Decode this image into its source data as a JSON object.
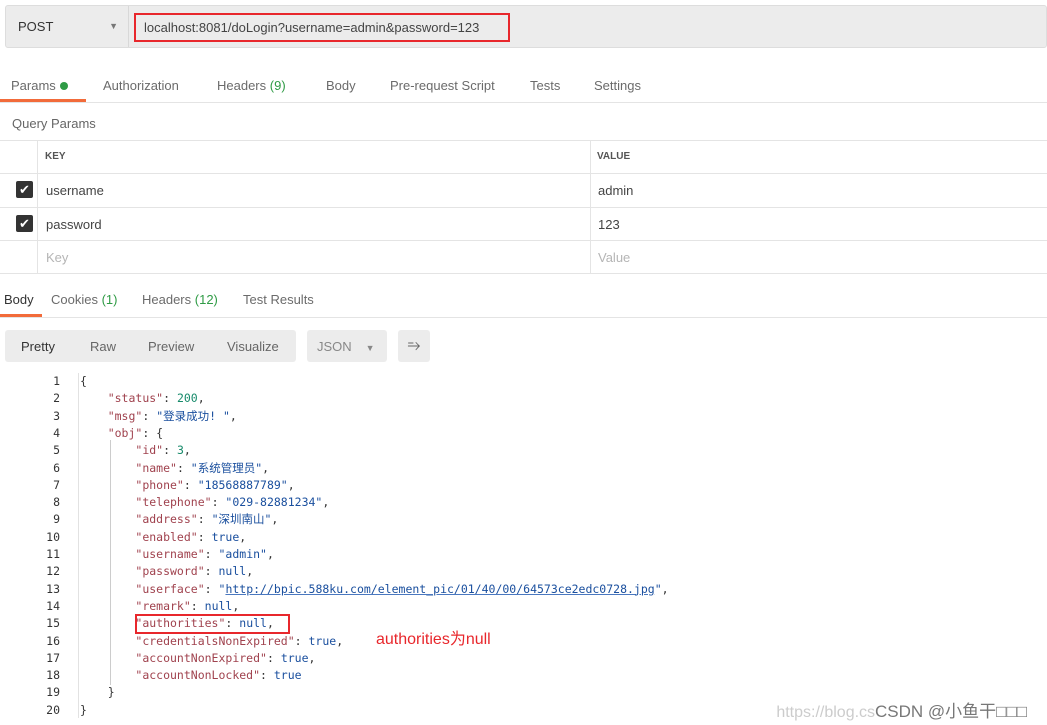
{
  "request": {
    "method": "POST",
    "url": "localhost:8081/doLogin?username=admin&password=123"
  },
  "req_tabs": [
    {
      "label": "Params",
      "active": true
    },
    {
      "label": "Authorization"
    },
    {
      "label": "Headers",
      "count": "(9)"
    },
    {
      "label": "Body"
    },
    {
      "label": "Pre-request Script"
    },
    {
      "label": "Tests"
    },
    {
      "label": "Settings"
    }
  ],
  "query_params": {
    "title": "Query Params",
    "headers": [
      "KEY",
      "VALUE"
    ],
    "rows": [
      {
        "checked": true,
        "key": "username",
        "value": "admin"
      },
      {
        "checked": true,
        "key": "password",
        "value": "123"
      }
    ],
    "placeholder": {
      "key": "Key",
      "value": "Value"
    }
  },
  "resp_tabs": [
    {
      "label": "Body",
      "active": true
    },
    {
      "label": "Cookies",
      "count": "(1)"
    },
    {
      "label": "Headers",
      "count": "(12)"
    },
    {
      "label": "Test Results"
    }
  ],
  "view_modes": [
    "Pretty",
    "Raw",
    "Preview",
    "Visualize"
  ],
  "format": "JSON",
  "code_lines": [
    [
      [
        "p",
        "{"
      ]
    ],
    [
      [
        "p",
        "    "
      ],
      [
        "k",
        "\"status\""
      ],
      [
        "p",
        ": "
      ],
      [
        "n",
        "200"
      ],
      [
        "p",
        ","
      ]
    ],
    [
      [
        "p",
        "    "
      ],
      [
        "k",
        "\"msg\""
      ],
      [
        "p",
        ": "
      ],
      [
        "s",
        "\"登录成功! \""
      ],
      [
        "p",
        ","
      ]
    ],
    [
      [
        "p",
        "    "
      ],
      [
        "k",
        "\"obj\""
      ],
      [
        "p",
        ": {"
      ]
    ],
    [
      [
        "p",
        "        "
      ],
      [
        "k",
        "\"id\""
      ],
      [
        "p",
        ": "
      ],
      [
        "n",
        "3"
      ],
      [
        "p",
        ","
      ]
    ],
    [
      [
        "p",
        "        "
      ],
      [
        "k",
        "\"name\""
      ],
      [
        "p",
        ": "
      ],
      [
        "s",
        "\"系统管理员\""
      ],
      [
        "p",
        ","
      ]
    ],
    [
      [
        "p",
        "        "
      ],
      [
        "k",
        "\"phone\""
      ],
      [
        "p",
        ": "
      ],
      [
        "s",
        "\"18568887789\""
      ],
      [
        "p",
        ","
      ]
    ],
    [
      [
        "p",
        "        "
      ],
      [
        "k",
        "\"telephone\""
      ],
      [
        "p",
        ": "
      ],
      [
        "s",
        "\"029-82881234\""
      ],
      [
        "p",
        ","
      ]
    ],
    [
      [
        "p",
        "        "
      ],
      [
        "k",
        "\"address\""
      ],
      [
        "p",
        ": "
      ],
      [
        "s",
        "\"深圳南山\""
      ],
      [
        "p",
        ","
      ]
    ],
    [
      [
        "p",
        "        "
      ],
      [
        "k",
        "\"enabled\""
      ],
      [
        "p",
        ": "
      ],
      [
        "b",
        "true"
      ],
      [
        "p",
        ","
      ]
    ],
    [
      [
        "p",
        "        "
      ],
      [
        "k",
        "\"username\""
      ],
      [
        "p",
        ": "
      ],
      [
        "s",
        "\"admin\""
      ],
      [
        "p",
        ","
      ]
    ],
    [
      [
        "p",
        "        "
      ],
      [
        "k",
        "\"password\""
      ],
      [
        "p",
        ": "
      ],
      [
        "b",
        "null"
      ],
      [
        "p",
        ","
      ]
    ],
    [
      [
        "p",
        "        "
      ],
      [
        "k",
        "\"userface\""
      ],
      [
        "p",
        ": "
      ],
      [
        "s",
        "\""
      ],
      [
        "s u",
        "http://bpic.588ku.com/element_pic/01/40/00/64573ce2edc0728.jpg"
      ],
      [
        "s",
        "\""
      ],
      [
        "p",
        ","
      ]
    ],
    [
      [
        "p",
        "        "
      ],
      [
        "k",
        "\"remark\""
      ],
      [
        "p",
        ": "
      ],
      [
        "b",
        "null"
      ],
      [
        "p",
        ","
      ]
    ],
    [
      [
        "p",
        "        "
      ],
      [
        "k",
        "\"authorities\""
      ],
      [
        "p",
        ": "
      ],
      [
        "b",
        "null"
      ],
      [
        "p",
        ","
      ]
    ],
    [
      [
        "p",
        "        "
      ],
      [
        "k",
        "\"credentialsNonExpired\""
      ],
      [
        "p",
        ": "
      ],
      [
        "b",
        "true"
      ],
      [
        "p",
        ","
      ]
    ],
    [
      [
        "p",
        "        "
      ],
      [
        "k",
        "\"accountNonExpired\""
      ],
      [
        "p",
        ": "
      ],
      [
        "b",
        "true"
      ],
      [
        "p",
        ","
      ]
    ],
    [
      [
        "p",
        "        "
      ],
      [
        "k",
        "\"accountNonLocked\""
      ],
      [
        "p",
        ": "
      ],
      [
        "b",
        "true"
      ]
    ],
    [
      [
        "p",
        "    }"
      ]
    ],
    [
      [
        "p",
        "}"
      ]
    ]
  ],
  "annotation": "authorities为null",
  "watermark": {
    "url": "https://blog.cs",
    "text": "CSDN @小鱼干□□□"
  },
  "colors": {
    "accent": "#f26b3a",
    "highlight": "#e8272c",
    "count": "#2f9b45"
  }
}
